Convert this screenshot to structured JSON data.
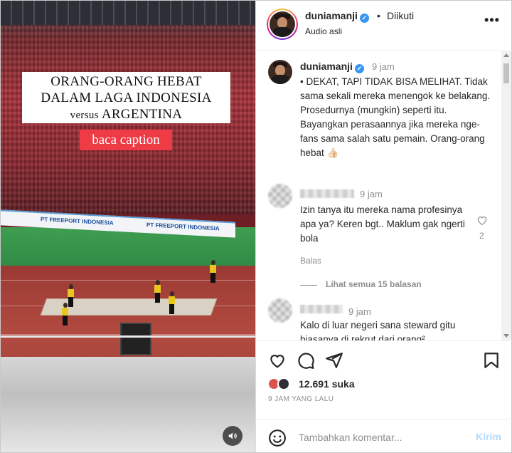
{
  "media": {
    "overlay_lines": [
      "ORANG-ORANG HEBAT",
      "DALAM LAGA INDONESIA",
      "versus",
      "ARGENTINA"
    ],
    "caption_tag": "baca caption",
    "adboard_text": "PT FREEPORT INDONESIA",
    "mute_icon": "speaker-icon"
  },
  "header": {
    "username": "duniamanji",
    "separator": "•",
    "follow_status": "Diikuti",
    "audio": "Audio asli",
    "more_icon": "more-icon"
  },
  "caption": {
    "username": "duniamanji",
    "time": "9 jam",
    "text": "• DEKAT, TAPI TIDAK BISA MELIHAT. Tidak sama sekali mereka menengok ke belakang. Prosedurnya (mungkin) seperti itu. Bayangkan perasaannya jika mereka nge-fans sama salah satu pemain. Orang-orang hebat 👍🏻"
  },
  "comments": [
    {
      "time": "9 jam",
      "text": "Izin tanya itu mereka nama profesinya apa ya? Keren bgt.. Maklum gak ngerti bola",
      "reply_label": "Balas",
      "likes": "2",
      "view_replies": "Lihat semua 15 balasan"
    },
    {
      "time": "9 jam",
      "text": "Kalo di luar negeri sana steward gitu biasanya di rekrut dari orang²"
    }
  ],
  "actions": {
    "like_icon": "heart-icon",
    "comment_icon": "comment-icon",
    "share_icon": "send-icon",
    "save_icon": "bookmark-icon",
    "likes_count": "12.691 suka",
    "post_time": "9 JAM YANG LALU"
  },
  "composer": {
    "placeholder": "Tambahkan komentar...",
    "send_label": "Kirim",
    "emoji_icon": "emoji-icon"
  },
  "colors": {
    "verified": "#3897f0",
    "caption_tag_bg": "#ef3b46",
    "send_disabled": "#b3dbff",
    "muted_text": "#8e8e8e"
  }
}
